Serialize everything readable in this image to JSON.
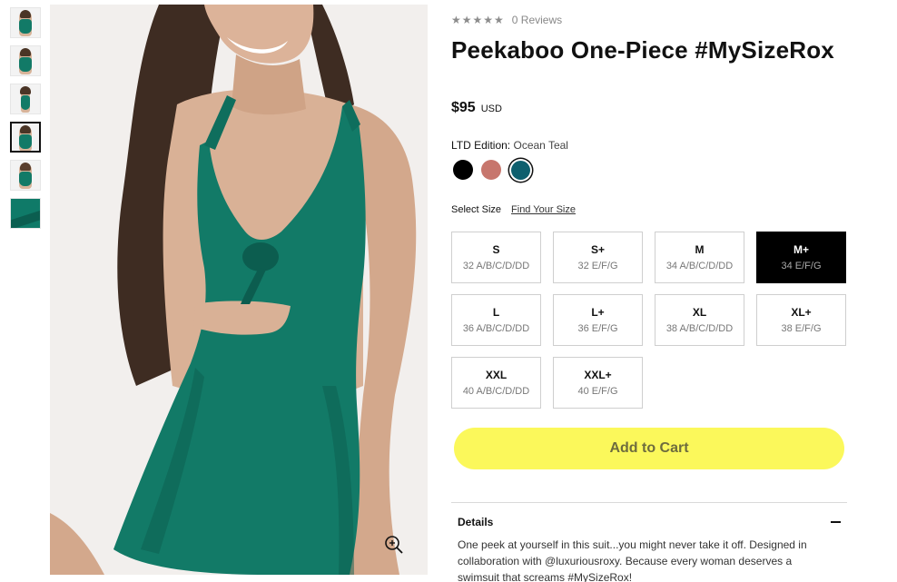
{
  "product": {
    "title": "Peekaboo One-Piece #MySizeRox",
    "price": "$95",
    "currency": "USD",
    "rating": {
      "stars": "★★★★★",
      "reviews": "0 Reviews"
    }
  },
  "color": {
    "label": "LTD Edition:",
    "value": "Ocean Teal",
    "swatches": [
      {
        "name": "Black",
        "hex": "#000000"
      },
      {
        "name": "Terracotta",
        "hex": "#c7766d"
      },
      {
        "name": "Ocean Teal",
        "hex": "#0e5f6e",
        "selected": true
      }
    ]
  },
  "size": {
    "label": "Select Size",
    "find_link": "Find Your Size",
    "options": [
      {
        "size": "S",
        "band": "32 A/B/C/D/DD"
      },
      {
        "size": "S+",
        "band": "32 E/F/G"
      },
      {
        "size": "M",
        "band": "34 A/B/C/D/DD"
      },
      {
        "size": "M+",
        "band": "34 E/F/G",
        "selected": true
      },
      {
        "size": "L",
        "band": "36 A/B/C/D/DD"
      },
      {
        "size": "L+",
        "band": "36 E/F/G"
      },
      {
        "size": "XL",
        "band": "38 A/B/C/D/DD"
      },
      {
        "size": "XL+",
        "band": "38 E/F/G"
      },
      {
        "size": "XXL",
        "band": "40 A/B/C/D/DD"
      },
      {
        "size": "XXL+",
        "band": "40 E/F/G"
      }
    ]
  },
  "cart": {
    "label": "Add to Cart"
  },
  "details": {
    "heading": "Details",
    "body": "One peek at yourself in this suit...you might never take it off. Designed in collaboration with @luxuriousroxy. Because every woman deserves a swimsuit that screams #MySizeRox!"
  },
  "colors": {
    "suit": "#127a67",
    "suit_shadow": "#0c5d4f",
    "skin": "#d9b196",
    "hair": "#3e2c22",
    "cart_bg": "#fbf85b"
  }
}
